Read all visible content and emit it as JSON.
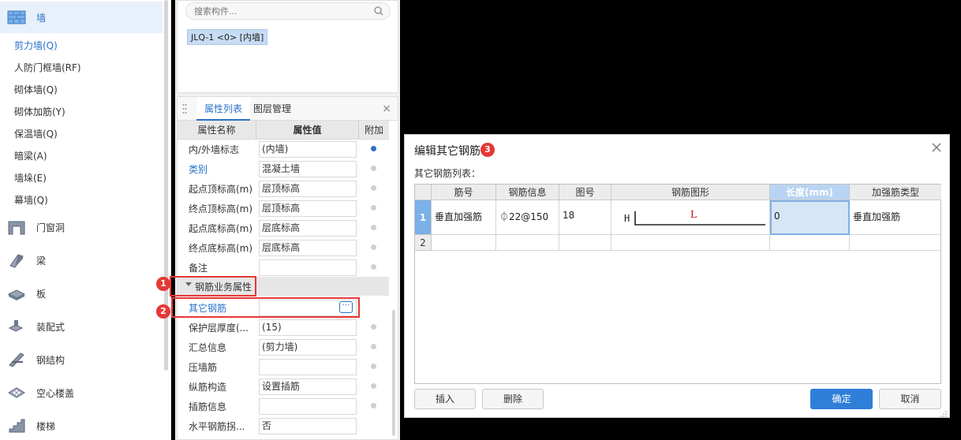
{
  "sidebar": {
    "wall": {
      "label": "墙"
    },
    "sub_items": [
      "剪力墙(Q)",
      "人防门框墙(RF)",
      "砌体墙(Q)",
      "砌体加筋(Y)",
      "保温墙(Q)",
      "暗梁(A)",
      "墙垛(E)",
      "幕墙(Q)"
    ],
    "categories": [
      "门窗洞",
      "梁",
      "板",
      "装配式",
      "钢结构",
      "空心楼盖",
      "楼梯"
    ]
  },
  "component_list": {
    "search_placeholder": "搜索构件...",
    "selected_item": "JLQ-1 <0> [内墙]"
  },
  "property_panel": {
    "tabs": [
      "属性列表",
      "图层管理"
    ],
    "close_symbol": "×",
    "headers": [
      "属性名称",
      "属性值",
      "附加"
    ],
    "rows": [
      {
        "name": "内/外墙标志",
        "value": "(内墙)",
        "attached": true
      },
      {
        "name": "类别",
        "value": "混凝土墙",
        "attached": false
      },
      {
        "name": "起点顶标高(m)",
        "value": "层顶标高",
        "attached": false
      },
      {
        "name": "终点顶标高(m)",
        "value": "层顶标高",
        "attached": false
      },
      {
        "name": "起点底标高(m)",
        "value": "层底标高",
        "attached": false
      },
      {
        "name": "终点底标高(m)",
        "value": "层底标高",
        "attached": false
      },
      {
        "name": "备注",
        "value": "",
        "attached": false
      }
    ],
    "group_label": "钢筋业务属性",
    "other_rebar_label": "其它钢筋",
    "ellipsis": "···",
    "rows2": [
      {
        "name": "保护层厚度(...",
        "value": "(15)"
      },
      {
        "name": "汇总信息",
        "value": "(剪力墙)"
      },
      {
        "name": "压墙筋",
        "value": ""
      },
      {
        "name": "纵筋构造",
        "value": "设置插筋"
      },
      {
        "name": "插筋信息",
        "value": ""
      },
      {
        "name": "水平钢筋拐...",
        "value": "否"
      }
    ]
  },
  "annotations": {
    "badge1": "1",
    "badge2": "2",
    "badge3": "3"
  },
  "dialog": {
    "title": "编辑其它钢筋",
    "subtitle": "其它钢筋列表：",
    "columns": [
      "筋号",
      "钢筋信息",
      "图号",
      "钢筋图形",
      "长度(mm)",
      "加强筋类型"
    ],
    "rows": [
      {
        "num": "1",
        "bar_no": "垂直加强筋",
        "rebar_info": "⏀22@150",
        "shape_no": "18",
        "shape_h": "H",
        "shape_l": "L",
        "length": "0",
        "type": "垂直加强筋"
      },
      {
        "num": "2"
      }
    ],
    "buttons": {
      "insert": "插入",
      "delete": "删除",
      "ok": "确定",
      "cancel": "取消"
    }
  },
  "colors": {
    "accent": "#2a72c8",
    "highlight": "#e53935",
    "primary_button": "#2f7fd8"
  }
}
